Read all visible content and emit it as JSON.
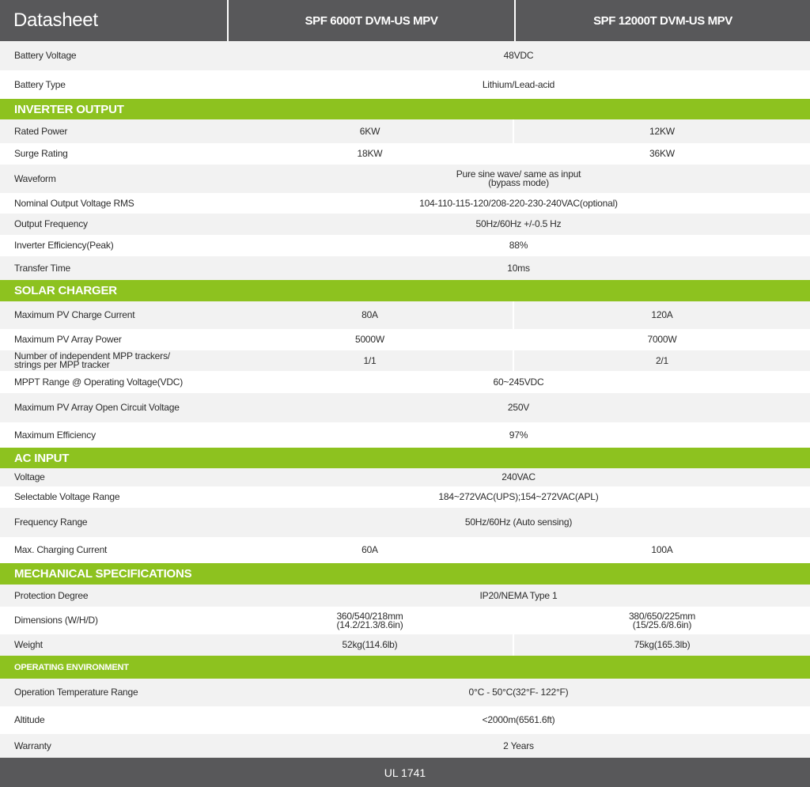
{
  "header": {
    "title": "Datasheet",
    "model_1": "SPF 6000T DVM-US MPV",
    "model_2": "SPF 12000T DVM-US MPV"
  },
  "rows": [
    {
      "type": "row",
      "label": "Battery Voltage",
      "value": "48VDC",
      "h": 37
    },
    {
      "type": "row",
      "label": "Battery Type",
      "value": "Lithium/Lead-acid",
      "h": 36
    },
    {
      "type": "section",
      "title": "INVERTER OUTPUT",
      "h": 26,
      "size": "big"
    },
    {
      "type": "row",
      "label": "Rated Power",
      "v1": "6KW",
      "v2": "12KW",
      "h": 30
    },
    {
      "type": "row",
      "label": "Surge Rating",
      "v1": "18KW",
      "v2": "36KW",
      "h": 27
    },
    {
      "type": "row",
      "label": "Waveform",
      "value": "Pure sine wave/ same as input\n(bypass mode)",
      "h": 36
    },
    {
      "type": "row",
      "label": "Nominal Output Voltage RMS",
      "value": "104-110-115-120/208-220-230-240VAC(optional)",
      "h": 26
    },
    {
      "type": "row",
      "label": "Output Frequency",
      "value": "50Hz/60Hz +/-0.5 Hz",
      "h": 27
    },
    {
      "type": "row",
      "label": "Inverter Efficiency(Peak)",
      "value": "88%",
      "h": 27
    },
    {
      "type": "row",
      "label": "Transfer Time",
      "value": "10ms",
      "h": 30
    },
    {
      "type": "section",
      "title": "SOLAR CHARGER",
      "h": 27,
      "size": "big"
    },
    {
      "type": "row",
      "label": "Maximum PV Charge Current",
      "v1": "80A",
      "v2": "120A",
      "h": 35
    },
    {
      "type": "row",
      "label": "Maximum PV Array Power",
      "v1": "5000W",
      "v2": "7000W",
      "h": 27
    },
    {
      "type": "row",
      "label": "Number of independent MPP trackers/\nstrings per MPP tracker",
      "v1": "1/1",
      "v2": "2/1",
      "h": 26
    },
    {
      "type": "row",
      "label": "MPPT Range @ Operating Voltage(VDC)",
      "value": "60~245VDC",
      "h": 28
    },
    {
      "type": "row",
      "label": "Maximum PV Array Open Circuit Voltage",
      "value": "250V",
      "h": 37
    },
    {
      "type": "row",
      "label": "Maximum Efficiency",
      "value": "97%",
      "h": 32
    },
    {
      "type": "section",
      "title": "AC INPUT",
      "h": 26,
      "size": "big"
    },
    {
      "type": "row",
      "label": "Voltage",
      "value": "240VAC",
      "h": 23
    },
    {
      "type": "row",
      "label": "Selectable Voltage Range",
      "value": "184~272VAC(UPS);154~272VAC(APL)",
      "h": 27
    },
    {
      "type": "row",
      "label": "Frequency Range",
      "value": "50Hz/60Hz (Auto sensing)",
      "h": 37
    },
    {
      "type": "row",
      "label": "Max. Charging Current",
      "v1": "60A",
      "v2": "100A",
      "h": 33
    },
    {
      "type": "section",
      "title": "MECHANICAL SPECIFICATIONS",
      "h": 27,
      "size": "big"
    },
    {
      "type": "row",
      "label": "Protection Degree",
      "value": "IP20/NEMA Type 1",
      "h": 28
    },
    {
      "type": "row",
      "label": "Dimensions (W/H/D)",
      "v1": "360/540/218mm\n(14.2/21.3/8.6in)",
      "v2": "380/650/225mm\n(15/25.6/8.6in)",
      "h": 35
    },
    {
      "type": "row",
      "label": "Weight",
      "v1": "52kg(114.6lb)",
      "v2": "75kg(165.3lb)",
      "h": 27
    },
    {
      "type": "section",
      "title": "OPERATING ENVIRONMENT",
      "h": 29,
      "size": "small"
    },
    {
      "type": "row",
      "label": "Operation Temperature Range",
      "value": "0°C - 50°C(32°F- 122°F)",
      "h": 35
    },
    {
      "type": "row",
      "label": "Altitude",
      "value": "<2000m(6561.6ft)",
      "h": 35
    },
    {
      "type": "row",
      "label": "Warranty",
      "value": "2 Years",
      "h": 31
    }
  ],
  "footer": {
    "text": "UL 1741"
  }
}
